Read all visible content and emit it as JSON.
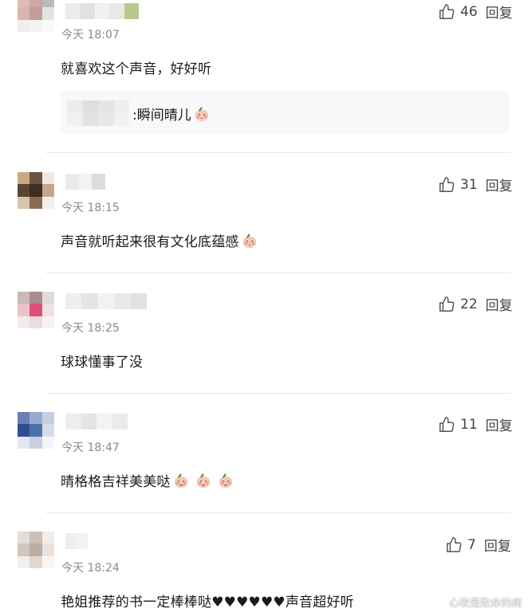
{
  "comments": [
    {
      "time": "今天 18:07",
      "text": "就喜欢这个声音，好好听",
      "likes": "46",
      "reply_label": "回复",
      "emoji_count": 0,
      "reply": {
        "text": ":瞬间晴儿"
      }
    },
    {
      "time": "今天 18:15",
      "text": "声音就听起来很有文化底蕴感",
      "likes": "31",
      "reply_label": "回复",
      "emoji_count": 1
    },
    {
      "time": "今天 18:25",
      "text": "球球懂事了没",
      "likes": "22",
      "reply_label": "回复",
      "emoji_count": 0
    },
    {
      "time": "今天 18:47",
      "text": "晴格格吉祥美美哒",
      "likes": "11",
      "reply_label": "回复",
      "emoji_count": 3
    },
    {
      "time": "今天 18:24",
      "text": "艳姐推荐的书一定棒棒哒♥♥♥♥♥♥声音超好听",
      "likes": "7",
      "reply_label": "回复",
      "emoji_count": 0
    }
  ],
  "watermark": "心软是致命的病",
  "colors": {
    "text": "#1a1a1a",
    "time": "#8a8a8a",
    "divider": "#e8e8e8",
    "reply_bg": "#f7f8fa"
  },
  "icons": {
    "like": "thumbs-up-icon",
    "emoji": "blushing-face-emoji"
  }
}
